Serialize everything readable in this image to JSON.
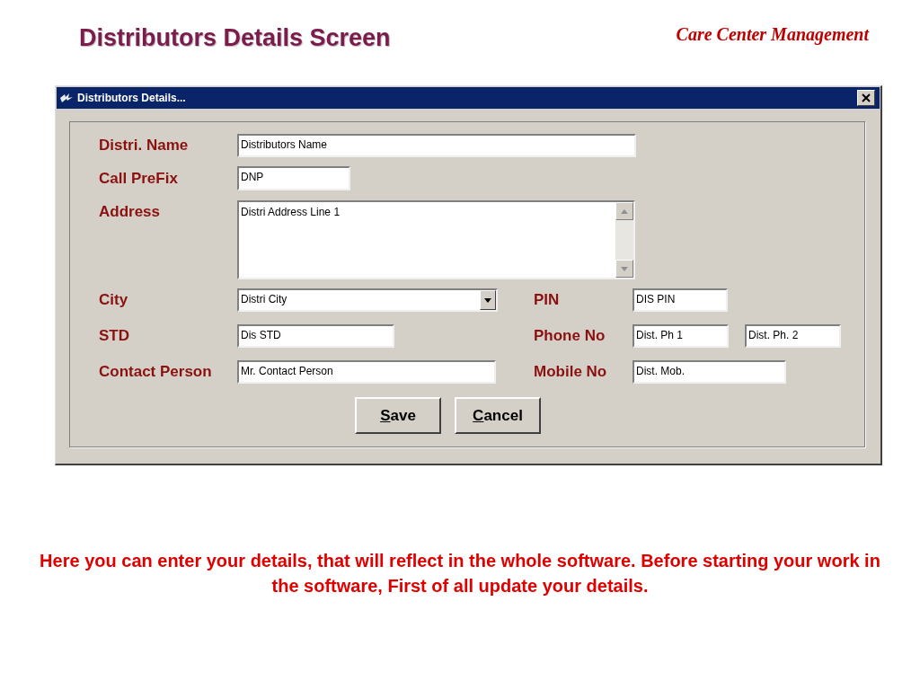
{
  "slide": {
    "title": "Distributors Details Screen",
    "brand": "Care Center Management",
    "caption": "Here you can enter your details, that will reflect in the whole software. Before starting your work in the software, First of all update your details."
  },
  "window": {
    "title": "Distributors Details..."
  },
  "form": {
    "name": {
      "label": "Distri. Name",
      "value": "Distributors Name"
    },
    "call_prefix": {
      "label": "Call PreFix",
      "value": "DNP"
    },
    "address": {
      "label": "Address",
      "value": "Distri Address Line 1"
    },
    "city": {
      "label": "City",
      "value": "Distri City"
    },
    "pin": {
      "label": "PIN",
      "value": "DIS PIN"
    },
    "std": {
      "label": "STD",
      "value": "Dis STD"
    },
    "phone": {
      "label": "Phone No",
      "values": [
        "Dist. Ph 1",
        "Dist. Ph. 2"
      ]
    },
    "contact_person": {
      "label": "Contact Person",
      "value": "Mr. Contact Person"
    },
    "mobile": {
      "label": "Mobile No",
      "value": "Dist. Mob."
    }
  },
  "buttons": [
    {
      "label": "Save"
    },
    {
      "label": "Cancel"
    }
  ]
}
